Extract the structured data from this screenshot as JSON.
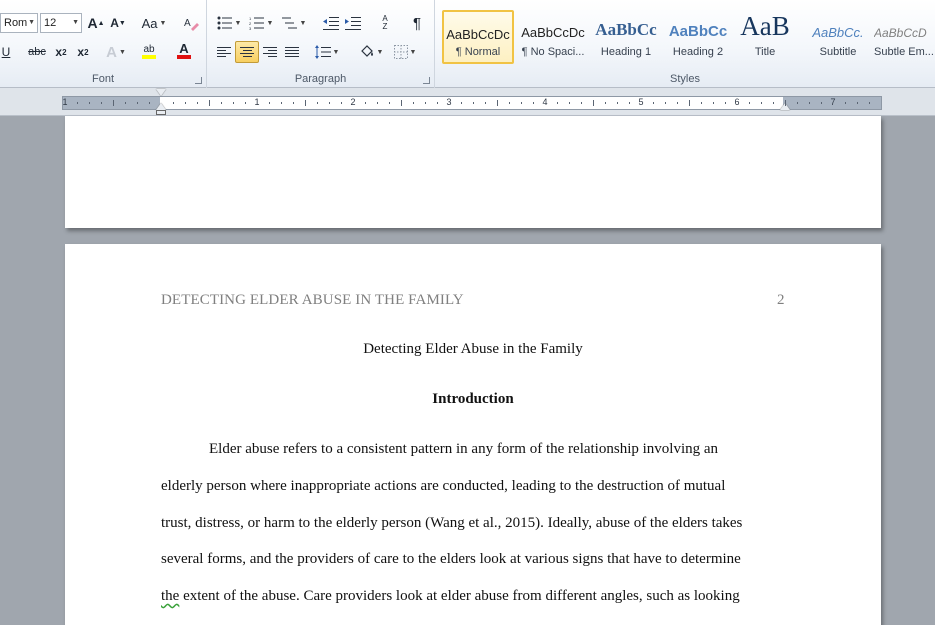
{
  "ribbon": {
    "font_group": {
      "label": "Font",
      "font_name": "Rom",
      "font_size": "12",
      "grow_font": "A",
      "shrink_font": "A",
      "change_case": "Aa",
      "strikethrough": "abc",
      "subscript_x": "x",
      "subscript_num": "2",
      "superscript_x": "x",
      "superscript_num": "2",
      "text_effects": "A",
      "highlight": "ab",
      "font_color": "A",
      "underline": "U"
    },
    "paragraph_group": {
      "label": "Paragraph",
      "show_formatting": "¶",
      "sort": "A Z"
    },
    "styles_group": {
      "label": "Styles",
      "items": [
        {
          "preview": "AaBbCcDc",
          "name": "¶ Normal"
        },
        {
          "preview": "AaBbCcDc",
          "name": "¶ No Spaci..."
        },
        {
          "preview": "AaBbCc",
          "name": "Heading 1"
        },
        {
          "preview": "AaBbCc",
          "name": "Heading 2"
        },
        {
          "preview": "AaB",
          "name": "Title"
        },
        {
          "preview": "AaBbCc.",
          "name": "Subtitle"
        },
        {
          "preview": "AaBbCcD",
          "name": "Subtle Em..."
        }
      ]
    },
    "colors": {
      "highlight": "#ffff00",
      "font_color": "#e01010",
      "accent": "#f1c344"
    }
  },
  "ruler": {
    "numbers": [
      "1",
      "1",
      "2",
      "3",
      "4",
      "5",
      "6",
      "7"
    ]
  },
  "document": {
    "header_title": "DETECTING ELDER ABUSE IN THE FAMILY",
    "page_number": "2",
    "title": "Detecting Elder Abuse in the Family",
    "heading": "Introduction",
    "paragraph_lines": [
      "Elder abuse refers to a consistent pattern in any form of the relationship involving an",
      "elderly person where inappropriate actions are conducted, leading to the destruction of mutual",
      "trust, distress, or harm to the elderly person (Wang et al., 2015). Ideally, abuse of the elders takes",
      "several forms, and the providers of care to the elders look at various signs that have to determine"
    ],
    "last_line_flagged": "the",
    "last_line_rest": " extent of the abuse. Care providers look at elder abuse from different angles, such as looking"
  }
}
